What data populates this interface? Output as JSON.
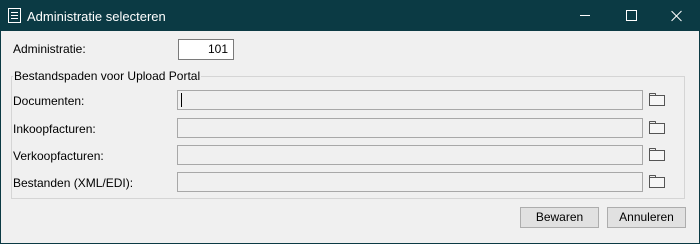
{
  "window": {
    "title": "Administratie selecteren",
    "icon": "form-icon"
  },
  "titlebar_buttons": [
    "minimize-icon",
    "maximize-icon",
    "close-icon"
  ],
  "administratie": {
    "label": "Administratie:",
    "value": "101"
  },
  "group": {
    "legend": "Bestandspaden voor Upload Portal",
    "fields": [
      {
        "label": "Documenten:",
        "value": "",
        "focused": true
      },
      {
        "label": "Inkoopfacturen:",
        "value": ""
      },
      {
        "label": "Verkoopfacturen:",
        "value": ""
      },
      {
        "label": "Bestanden (XML/EDI):",
        "value": ""
      }
    ],
    "browse_icon": "folder-icon"
  },
  "buttons": {
    "save": "Bewaren",
    "cancel": "Annuleren"
  }
}
